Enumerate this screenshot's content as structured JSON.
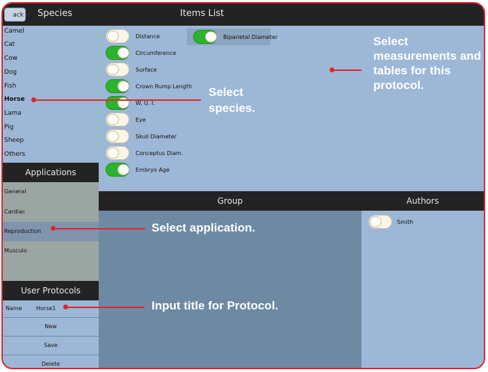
{
  "topbar": {
    "back_label": "ack",
    "species_title": "Species",
    "items_title": "Items List"
  },
  "species": {
    "items": [
      {
        "label": "Camel",
        "selected": false
      },
      {
        "label": "Cat",
        "selected": false
      },
      {
        "label": "Cow",
        "selected": false
      },
      {
        "label": "Dog",
        "selected": false
      },
      {
        "label": "Fish",
        "selected": false
      },
      {
        "label": "Horse",
        "selected": true
      },
      {
        "label": "Lama",
        "selected": false
      },
      {
        "label": "Pig",
        "selected": false
      },
      {
        "label": "Sheep",
        "selected": false
      },
      {
        "label": "Others",
        "selected": false
      }
    ]
  },
  "applications": {
    "title": "Applications",
    "items": [
      {
        "label": "General",
        "selected": false
      },
      {
        "label": "Cardiac",
        "selected": false
      },
      {
        "label": "Reproduction",
        "selected": true
      },
      {
        "label": "Musculo",
        "selected": false
      }
    ]
  },
  "user_protocols": {
    "title": "User Protocols",
    "name_label": "Name",
    "name_value": "Horse1",
    "new_label": "New",
    "save_label": "Save",
    "delete_label": "Delete"
  },
  "items_list": {
    "items": [
      {
        "label": "Distance",
        "on": false
      },
      {
        "label": "Circumference",
        "on": true
      },
      {
        "label": "Surface",
        "on": false
      },
      {
        "label": "Crown Rump Length",
        "on": true
      },
      {
        "label": "W. U. I.",
        "on": true
      },
      {
        "label": "Eye",
        "on": false
      },
      {
        "label": "Skull Diameter",
        "on": false
      },
      {
        "label": "Conceptus Diam.",
        "on": false
      },
      {
        "label": "Embryo Age",
        "on": true
      },
      {
        "label": "Biparietal Diameter",
        "on": true
      }
    ]
  },
  "group": {
    "title": "Group"
  },
  "authors": {
    "title": "Authors",
    "items": [
      {
        "label": "Smith",
        "on": false
      }
    ]
  },
  "callouts": {
    "measurements": "Select measurements and tables for this protocol.",
    "species": "Select species.",
    "application": "Select application.",
    "title": "Input title for Protocol."
  },
  "colors": {
    "accent_red": "#e0242b",
    "toggle_on": "#2ab52c",
    "panel_blue": "#9db7d6",
    "header_dark": "#232323"
  }
}
